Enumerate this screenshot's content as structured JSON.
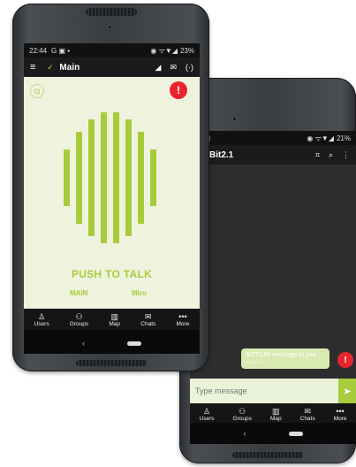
{
  "front": {
    "statusbar": {
      "time": "22:44",
      "left_icons": "G ▣ ▪",
      "right_icons": "◉ ᯤ▼◢",
      "battery": "23%"
    },
    "appbar": {
      "menu_icon": "≡",
      "title": "Main",
      "signal_icon": "◢",
      "mail_icon": "✉",
      "radio_icon": "(·)"
    },
    "ptt": {
      "label": "PUSH TO TALK",
      "channel": "MAIN",
      "user": "Miro"
    },
    "bottom_nav": [
      {
        "icon": "♙",
        "label": "Users"
      },
      {
        "icon": "⚇",
        "label": "Groups"
      },
      {
        "icon": "▥",
        "label": "Map"
      },
      {
        "icon": "✉",
        "label": "Chats"
      },
      {
        "icon": "•••",
        "label": "More"
      }
    ],
    "sysnav": {
      "back": "‹"
    }
  },
  "back": {
    "statusbar": {
      "left_icons": "▣ ▣",
      "right_icons": "◉ ᯤ▼◢",
      "battery": "21%"
    },
    "appbar": {
      "title": "Bit2.1",
      "scan_icon": "⌗",
      "attach_icon": "⌕",
      "more_icon": "⋮"
    },
    "message": {
      "text": "BITTIUM message to you",
      "time": "just now"
    },
    "composer": {
      "placeholder": "Type message",
      "send_icon": "➤"
    },
    "bottom_nav": [
      {
        "icon": "♙",
        "label": "Users"
      },
      {
        "icon": "⚇",
        "label": "Groups"
      },
      {
        "icon": "▥",
        "label": "Map"
      },
      {
        "icon": "✉",
        "label": "Chats"
      },
      {
        "icon": "•••",
        "label": "More"
      }
    ],
    "sysnav": {
      "back": "‹"
    }
  },
  "colors": {
    "accent": "#a7cc3b",
    "alert": "#e8252d",
    "ptt_bg": "#eff3de"
  }
}
